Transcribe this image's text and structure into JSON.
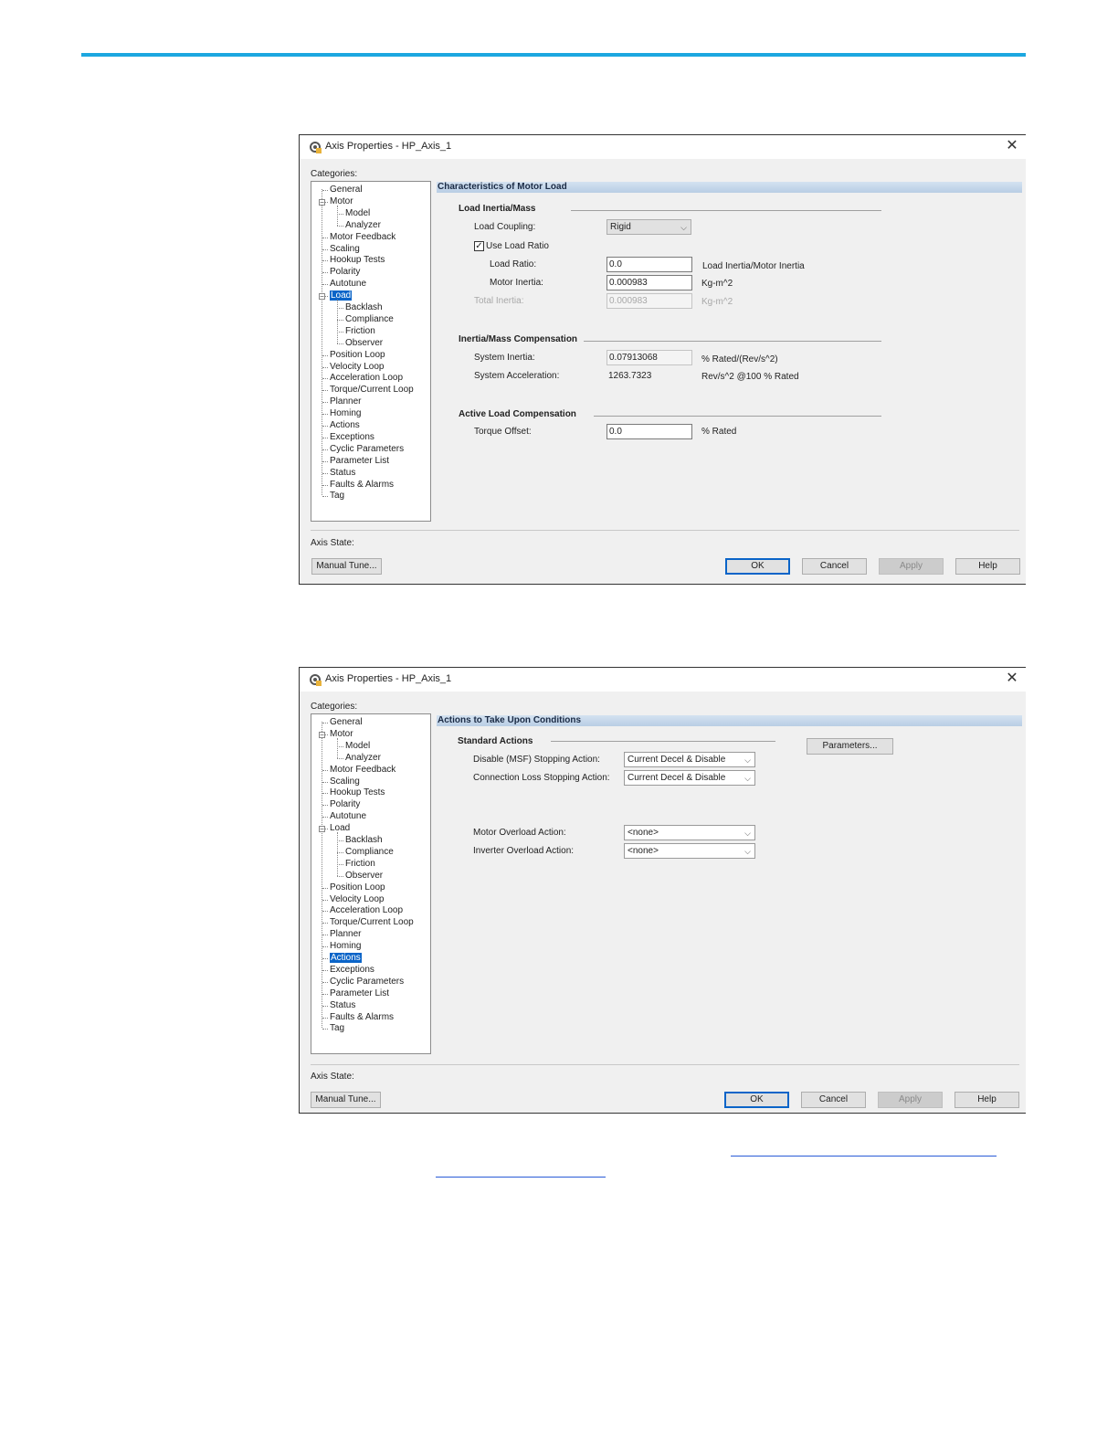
{
  "dialog1": {
    "title": "Axis Properties - HP_Axis_1",
    "categories_label": "Categories:",
    "section_title": "Characteristics of Motor Load",
    "groups": {
      "load_inertia": "Load Inertia/Mass",
      "compensation": "Inertia/Mass Compensation",
      "active_load": "Active Load Compensation"
    },
    "fields": {
      "load_coupling_label": "Load Coupling:",
      "load_coupling_value": "Rigid",
      "use_load_ratio_label": "Use Load Ratio",
      "load_ratio_label": "Load Ratio:",
      "load_ratio_value": "0.0",
      "load_ratio_unit": "Load Inertia/Motor Inertia",
      "motor_inertia_label": "Motor Inertia:",
      "motor_inertia_value": "0.000983",
      "motor_inertia_unit": "Kg-m^2",
      "total_inertia_label": "Total Inertia:",
      "total_inertia_value": "0.000983",
      "total_inertia_unit": "Kg-m^2",
      "system_inertia_label": "System Inertia:",
      "system_inertia_value": "0.07913068",
      "system_inertia_unit": "% Rated/(Rev/s^2)",
      "system_accel_label": "System Acceleration:",
      "system_accel_value": "1263.7323",
      "system_accel_unit": "Rev/s^2 @100 % Rated",
      "torque_offset_label": "Torque Offset:",
      "torque_offset_value": "0.0",
      "torque_offset_unit": "% Rated"
    },
    "axis_state_label": "Axis State:",
    "buttons": {
      "manual_tune": "Manual Tune...",
      "ok": "OK",
      "cancel": "Cancel",
      "apply": "Apply",
      "help": "Help"
    }
  },
  "dialog2": {
    "title": "Axis Properties - HP_Axis_1",
    "categories_label": "Categories:",
    "section_title": "Actions to Take Upon Conditions",
    "groups": {
      "standard_actions": "Standard Actions"
    },
    "parameters_button": "Parameters...",
    "fields": {
      "disable_label": "Disable (MSF) Stopping Action:",
      "disable_value": "Current Decel & Disable",
      "connection_loss_label": "Connection Loss Stopping Action:",
      "connection_loss_value": "Current Decel & Disable",
      "motor_overload_label": "Motor Overload Action:",
      "motor_overload_value": "<none>",
      "inverter_overload_label": "Inverter Overload Action:",
      "inverter_overload_value": "<none>"
    },
    "axis_state_label": "Axis State:",
    "buttons": {
      "manual_tune": "Manual Tune...",
      "ok": "OK",
      "cancel": "Cancel",
      "apply": "Apply",
      "help": "Help"
    }
  },
  "tree": {
    "general": "General",
    "motor": "Motor",
    "model": "Model",
    "analyzer": "Analyzer",
    "motor_feedback": "Motor Feedback",
    "scaling": "Scaling",
    "hookup_tests": "Hookup Tests",
    "polarity": "Polarity",
    "autotune": "Autotune",
    "load": "Load",
    "backlash": "Backlash",
    "compliance": "Compliance",
    "friction": "Friction",
    "observer": "Observer",
    "position_loop": "Position Loop",
    "velocity_loop": "Velocity Loop",
    "acceleration_loop": "Acceleration Loop",
    "torque_current_loop": "Torque/Current Loop",
    "planner": "Planner",
    "homing": "Homing",
    "actions": "Actions",
    "exceptions": "Exceptions",
    "cyclic_parameters": "Cyclic Parameters",
    "parameter_list": "Parameter List",
    "status": "Status",
    "faults_alarms": "Faults & Alarms",
    "tag": "Tag"
  },
  "tree_selected": {
    "dialog1": "load",
    "dialog2": "actions"
  }
}
